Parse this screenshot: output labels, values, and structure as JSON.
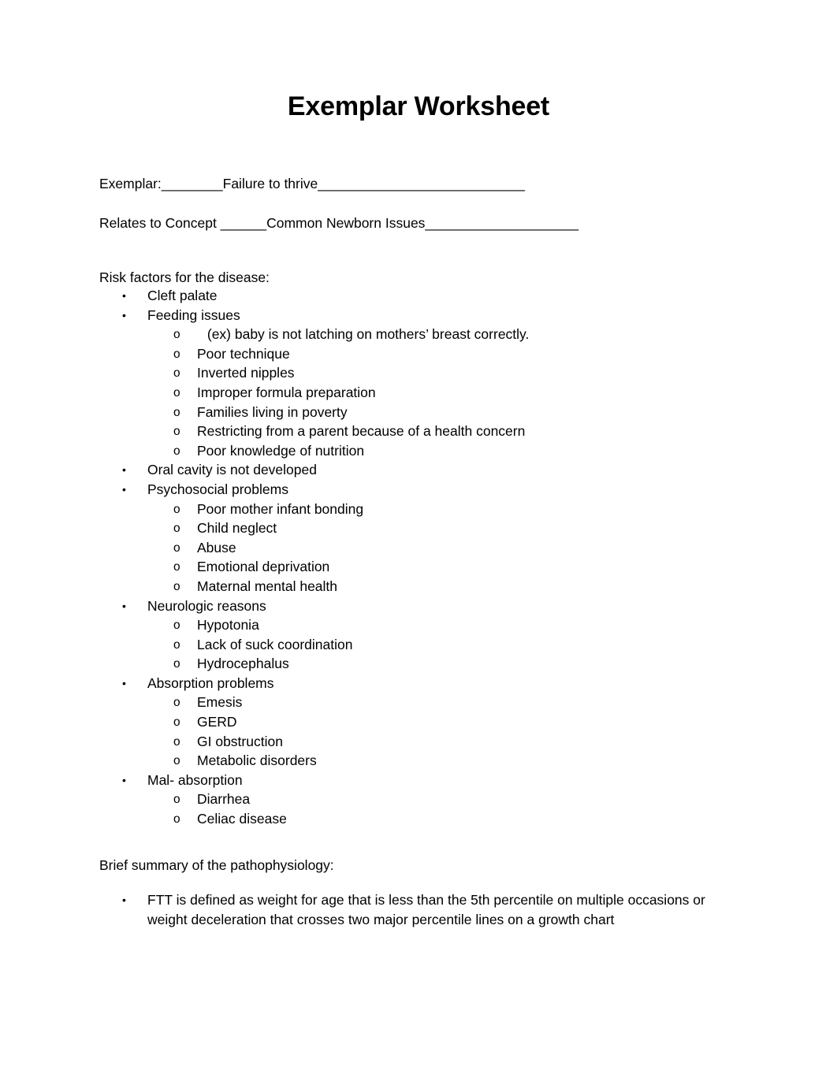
{
  "document": {
    "title": "Exemplar Worksheet",
    "fields": {
      "exemplar_line": "Exemplar:________Failure to thrive___________________________",
      "concept_line": "Relates to Concept ______Common Newborn Issues____________________"
    },
    "risk_section": {
      "heading": "Risk factors for the disease:",
      "bullet_marker": "•",
      "sub_marker": "o",
      "items": [
        {
          "level": 1,
          "text": "Cleft palate"
        },
        {
          "level": 1,
          "text": "Feeding issues"
        },
        {
          "level": 2,
          "text": " (ex) baby is not latching on mothers’ breast correctly.",
          "extra_space": true
        },
        {
          "level": 2,
          "text": "Poor technique"
        },
        {
          "level": 2,
          "text": "Inverted nipples"
        },
        {
          "level": 2,
          "text": "Improper formula preparation"
        },
        {
          "level": 2,
          "text": "Families living in poverty"
        },
        {
          "level": 2,
          "text": "Restricting from a parent because of a health concern"
        },
        {
          "level": 2,
          "text": "Poor knowledge of nutrition"
        },
        {
          "level": 1,
          "text": "Oral cavity is not developed"
        },
        {
          "level": 1,
          "text": "Psychosocial problems"
        },
        {
          "level": 2,
          "text": "Poor mother infant bonding"
        },
        {
          "level": 2,
          "text": "Child neglect"
        },
        {
          "level": 2,
          "text": "Abuse"
        },
        {
          "level": 2,
          "text": "Emotional deprivation"
        },
        {
          "level": 2,
          "text": "Maternal mental health"
        },
        {
          "level": 1,
          "text": "Neurologic reasons"
        },
        {
          "level": 2,
          "text": "Hypotonia"
        },
        {
          "level": 2,
          "text": "Lack of suck coordination"
        },
        {
          "level": 2,
          "text": "Hydrocephalus"
        },
        {
          "level": 1,
          "text": "Absorption problems"
        },
        {
          "level": 2,
          "text": "Emesis"
        },
        {
          "level": 2,
          "text": "GERD"
        },
        {
          "level": 2,
          "text": "GI obstruction"
        },
        {
          "level": 2,
          "text": "Metabolic disorders"
        },
        {
          "level": 1,
          "text": "Mal- absorption"
        },
        {
          "level": 2,
          "text": "Diarrhea"
        },
        {
          "level": 2,
          "text": "Celiac disease"
        }
      ]
    },
    "patho_section": {
      "heading": "Brief summary of the pathophysiology:",
      "bullet_marker": "•",
      "items": [
        "FTT is defined as weight for age that is less than the 5th percentile on multiple occasions or weight deceleration that crosses two major percentile lines on a growth chart"
      ]
    }
  }
}
